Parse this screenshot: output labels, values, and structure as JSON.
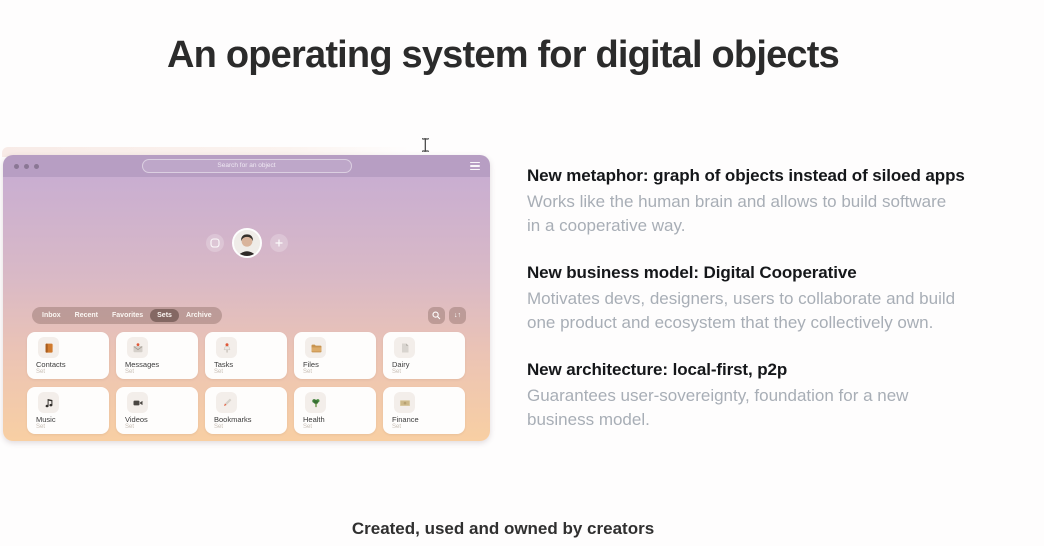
{
  "page": {
    "title": "An operating system for digital objects",
    "footer": "Created, used and owned by creators"
  },
  "window": {
    "search_placeholder": "Search for an object",
    "tabs": [
      {
        "label": "Inbox",
        "selected": false
      },
      {
        "label": "Recent",
        "selected": false
      },
      {
        "label": "Favorites",
        "selected": false
      },
      {
        "label": "Sets",
        "selected": true
      },
      {
        "label": "Archive",
        "selected": false
      }
    ],
    "toolbar": {
      "sort_glyph": "↓↑"
    },
    "cards": [
      {
        "label": "Contacts",
        "sublabel": "Set",
        "icon": "contacts"
      },
      {
        "label": "Messages",
        "sublabel": "Set",
        "icon": "messages"
      },
      {
        "label": "Tasks",
        "sublabel": "Set",
        "icon": "tasks"
      },
      {
        "label": "Files",
        "sublabel": "Set",
        "icon": "files"
      },
      {
        "label": "Dairy",
        "sublabel": "Set",
        "icon": "dairy"
      },
      {
        "label": "Music",
        "sublabel": "Set",
        "icon": "music"
      },
      {
        "label": "Videos",
        "sublabel": "Set",
        "icon": "videos"
      },
      {
        "label": "Bookmarks",
        "sublabel": "Set",
        "icon": "bookmarks"
      },
      {
        "label": "Health",
        "sublabel": "Set",
        "icon": "health"
      },
      {
        "label": "Finance",
        "sublabel": "Set",
        "icon": "finance"
      }
    ]
  },
  "right_panel": {
    "sections": [
      {
        "heading": "New metaphor: graph of objects instead of siloed apps",
        "body": "Works like the human brain and allows to build software\nin a cooperative way."
      },
      {
        "heading": "New business model: Digital Cooperative",
        "body": "Motivates devs, designers, users to collaborate and build\none product and ecosystem that they collectively own."
      },
      {
        "heading": "New architecture: local-first, p2p",
        "body": "Guarantees user-sovereignty, foundation for a new\nbusiness model."
      }
    ]
  },
  "colors": {
    "titlebar": "#b79ec3",
    "gradient_top": "#c9aed1",
    "gradient_bottom": "#f8cfa3",
    "tab_pill": "rgba(133,103,94,0.40)",
    "tab_selected": "rgba(86,62,56,0.55)",
    "card_bg": "#fefdfc",
    "heading_text": "#15171a",
    "body_text": "#a8aeb6"
  }
}
